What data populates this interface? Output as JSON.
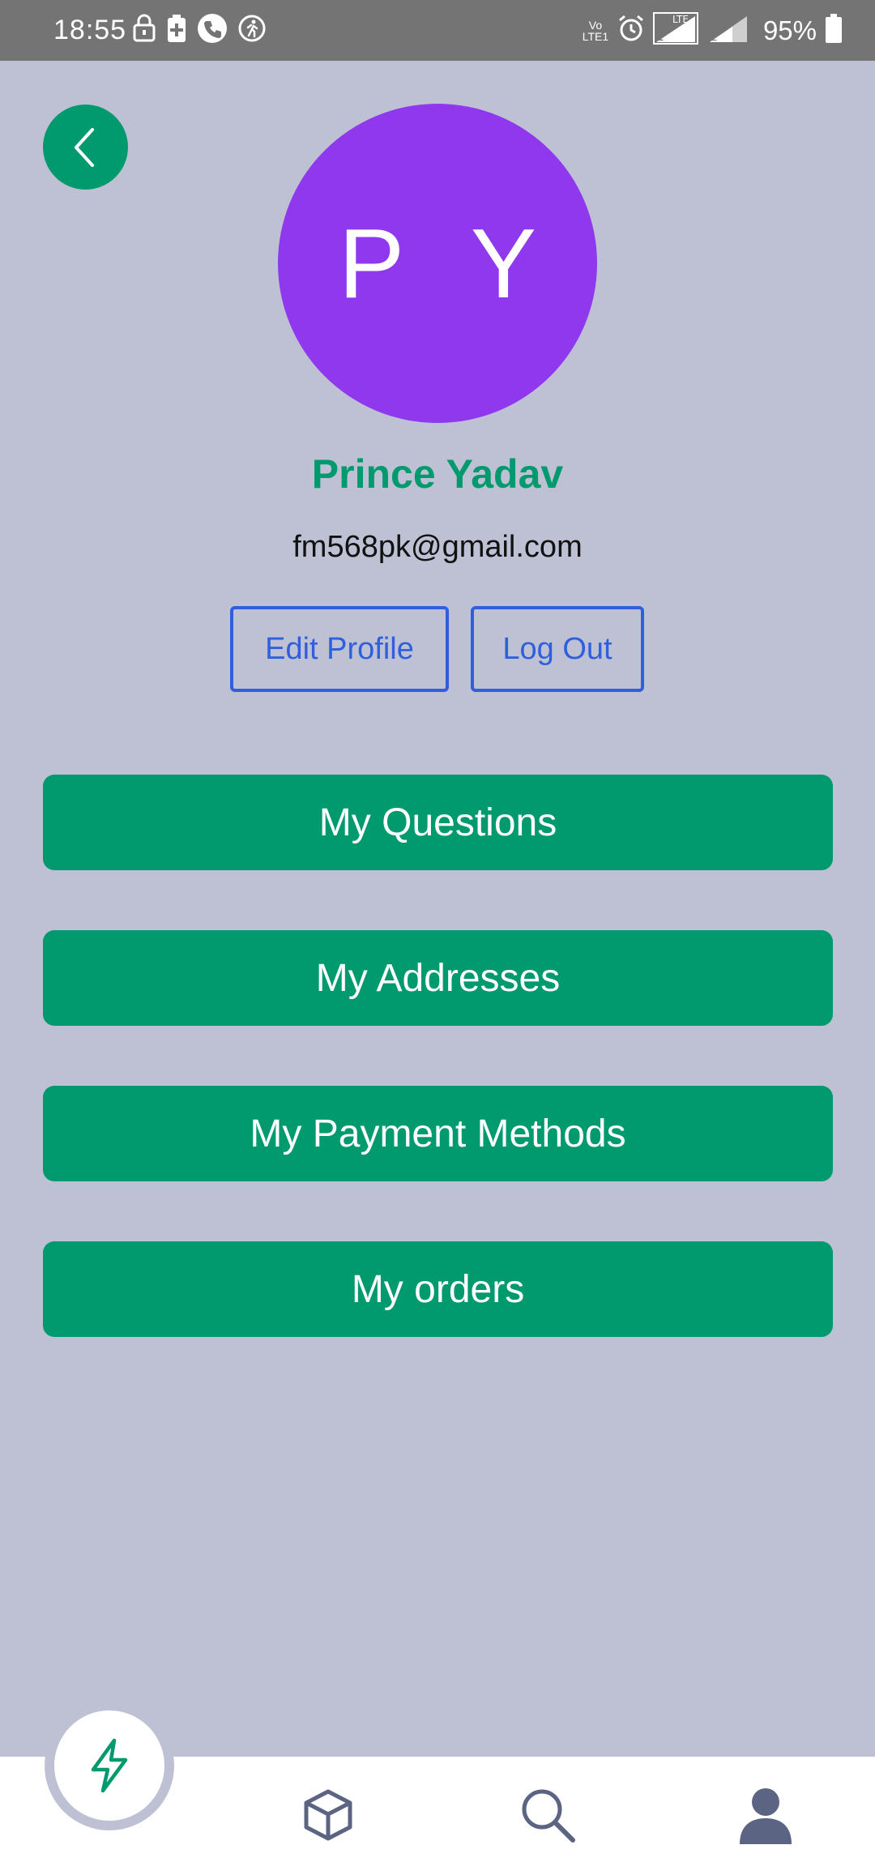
{
  "status_bar": {
    "time": "18:55",
    "volte": "Vo\nLTE1",
    "lte": "LTE",
    "sim1": "1",
    "sim2": "2",
    "battery": "95%"
  },
  "profile": {
    "initials": "P Y",
    "name": "Prince Yadav",
    "email": "fm568pk@gmail.com",
    "edit_label": "Edit Profile",
    "logout_label": "Log Out"
  },
  "menu": {
    "items": [
      {
        "label": "My Questions"
      },
      {
        "label": "My Addresses"
      },
      {
        "label": "My Payment Methods"
      },
      {
        "label": "My orders"
      }
    ]
  },
  "bottom_nav": {
    "items": [
      {
        "icon": "lightning-icon",
        "active": true
      },
      {
        "icon": "box-icon"
      },
      {
        "icon": "search-icon"
      },
      {
        "icon": "user-icon"
      }
    ]
  },
  "colors": {
    "accent": "#019a6e",
    "avatar": "#8f38ee",
    "outline": "#2f5fdc",
    "background": "#bec1d3",
    "nav_icon": "#5b6583"
  }
}
